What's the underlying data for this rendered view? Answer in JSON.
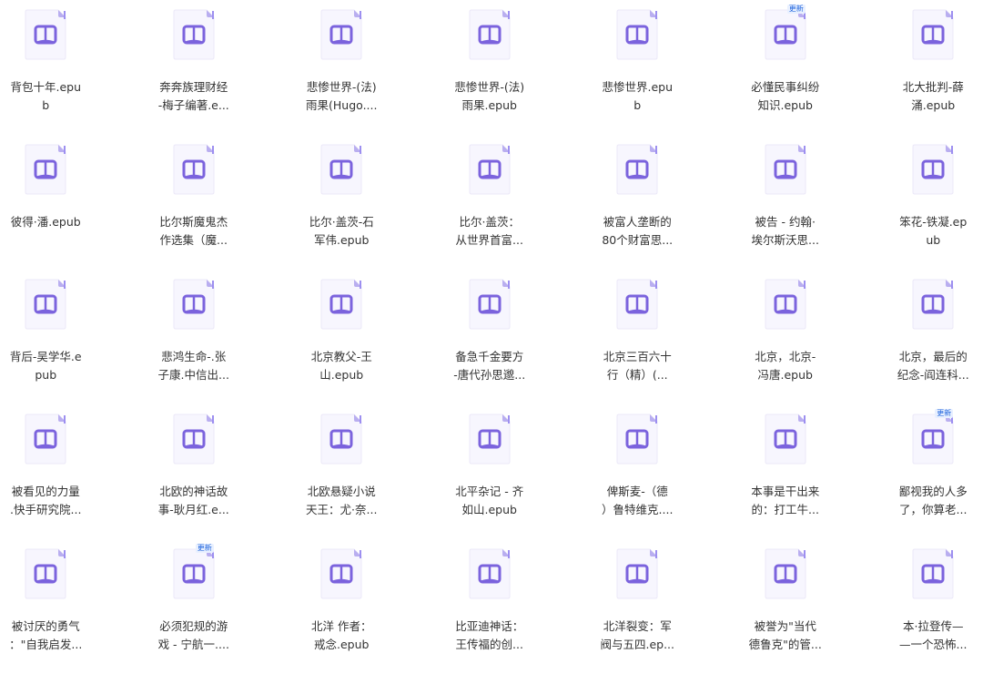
{
  "accent_color": "#6f5bd9",
  "badge_color": "#2266dd",
  "files": [
    {
      "line1": "背包十年.epu",
      "line2": "b",
      "badge": ""
    },
    {
      "line1": "奔奔族理财经",
      "line2": "-梅子编著.e...",
      "badge": ""
    },
    {
      "line1": "悲惨世界-(法)",
      "line2": "雨果(Hugo....",
      "badge": ""
    },
    {
      "line1": "悲惨世界-(法)",
      "line2": "雨果.epub",
      "badge": ""
    },
    {
      "line1": "悲惨世界.epu",
      "line2": "b",
      "badge": ""
    },
    {
      "line1": "必懂民事纠纷",
      "line2": "知识.epub",
      "badge": "更新"
    },
    {
      "line1": "北大批判-薛",
      "line2": "涌.epub",
      "badge": ""
    },
    {
      "line1": "彼得·潘.epub",
      "line2": "",
      "badge": ""
    },
    {
      "line1": "比尔斯魔鬼杰",
      "line2": "作选集（魔...",
      "badge": ""
    },
    {
      "line1": "比尔·盖茨-石",
      "line2": "军伟.epub",
      "badge": ""
    },
    {
      "line1": "比尔·盖茨：",
      "line2": "从世界首富...",
      "badge": ""
    },
    {
      "line1": "被富人垄断的",
      "line2": "80个财富思...",
      "badge": ""
    },
    {
      "line1": "被告 - 约翰·",
      "line2": "埃尔斯沃思...",
      "badge": ""
    },
    {
      "line1": "笨花-铁凝.ep",
      "line2": "ub",
      "badge": ""
    },
    {
      "line1": "背后-吴学华.e",
      "line2": "pub",
      "badge": ""
    },
    {
      "line1": "悲鸿生命-.张",
      "line2": "子康.中信出...",
      "badge": ""
    },
    {
      "line1": "北京教父-王",
      "line2": "山.epub",
      "badge": ""
    },
    {
      "line1": "备急千金要方",
      "line2": "-唐代孙思邈...",
      "badge": ""
    },
    {
      "line1": "北京三百六十",
      "line2": "行（精）(...",
      "badge": ""
    },
    {
      "line1": "北京，北京-",
      "line2": "冯唐.epub",
      "badge": ""
    },
    {
      "line1": "北京，最后的",
      "line2": "纪念-阎连科...",
      "badge": ""
    },
    {
      "line1": "被看见的力量",
      "line2": ".快手研究院...",
      "badge": ""
    },
    {
      "line1": "北欧的神话故",
      "line2": "事-耿月红.e...",
      "badge": ""
    },
    {
      "line1": "北欧悬疑小说",
      "line2": "天王：尤·奈...",
      "badge": ""
    },
    {
      "line1": "北平杂记 - 齐",
      "line2": "如山.epub",
      "badge": ""
    },
    {
      "line1": "俾斯麦-（德",
      "line2": "）鲁特维克....",
      "badge": ""
    },
    {
      "line1": "本事是干出来",
      "line2": "的：打工牛...",
      "badge": ""
    },
    {
      "line1": "鄙视我的人多",
      "line2": "了，你算老...",
      "badge": "更新"
    },
    {
      "line1": "被讨厌的勇气",
      "line2": "：\"自我启发...",
      "badge": ""
    },
    {
      "line1": "必须犯规的游",
      "line2": "戏 - 宁航一....",
      "badge": "更新"
    },
    {
      "line1": "北洋 作者：",
      "line2": "戒念.epub",
      "badge": ""
    },
    {
      "line1": "比亚迪神话：",
      "line2": "王传福的创...",
      "badge": ""
    },
    {
      "line1": "北洋裂变：军",
      "line2": "阀与五四.ep...",
      "badge": ""
    },
    {
      "line1": "被誉为\"当代",
      "line2": "德鲁克\"的管...",
      "badge": ""
    },
    {
      "line1": "本·拉登传—",
      "line2": "—一个恐怖...",
      "badge": ""
    }
  ]
}
